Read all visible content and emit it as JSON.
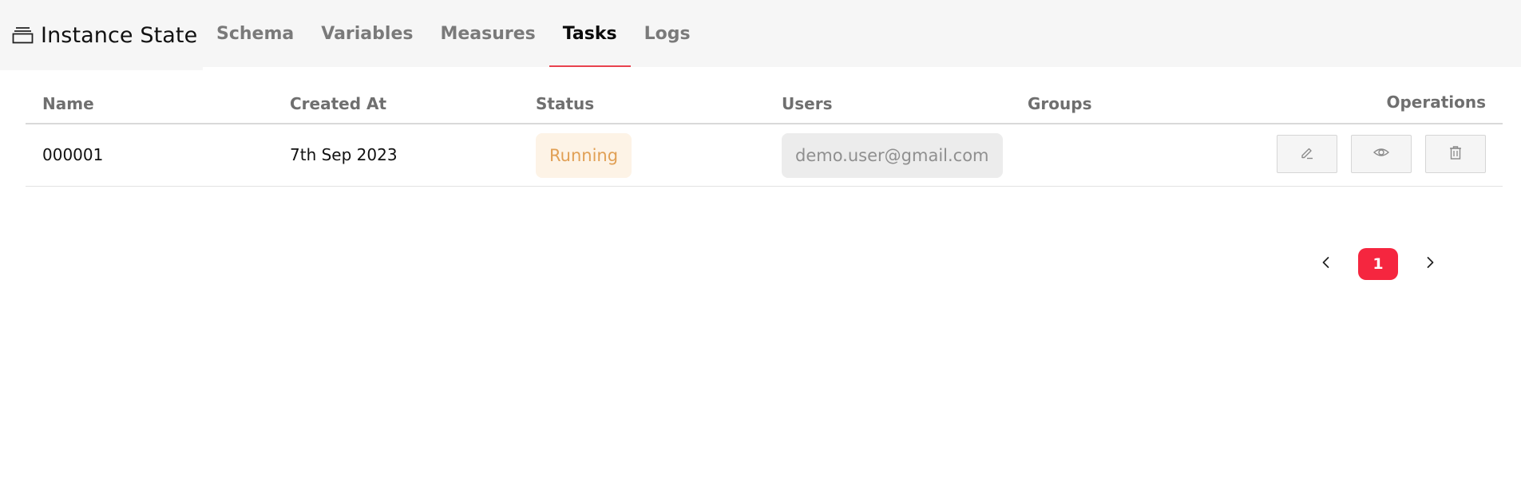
{
  "app": {
    "title": "Instance State",
    "title_icon": "stacked-window-icon"
  },
  "tabs": [
    {
      "label": "Schema",
      "active": false
    },
    {
      "label": "Variables",
      "active": false
    },
    {
      "label": "Measures",
      "active": false
    },
    {
      "label": "Tasks",
      "active": true
    },
    {
      "label": "Logs",
      "active": false
    }
  ],
  "table": {
    "headers": {
      "name": "Name",
      "created_at": "Created At",
      "status": "Status",
      "users": "Users",
      "groups": "Groups",
      "operations": "Operations"
    },
    "rows": [
      {
        "name": "000001",
        "created_at": "7th Sep 2023",
        "status": "Running",
        "users": "demo.user@gmail.com",
        "groups": "",
        "operations": [
          "edit-icon",
          "view-icon",
          "delete-icon"
        ]
      }
    ]
  },
  "pagination": {
    "current_page": "1",
    "prev_icon": "chevron-left-icon",
    "next_icon": "chevron-right-icon"
  },
  "colors": {
    "accent": "#e8424e",
    "pagination_active": "#f5263f",
    "status_running_bg": "#fdf3e6",
    "status_running_text": "#e1a055",
    "user_chip_bg": "#ececec"
  }
}
